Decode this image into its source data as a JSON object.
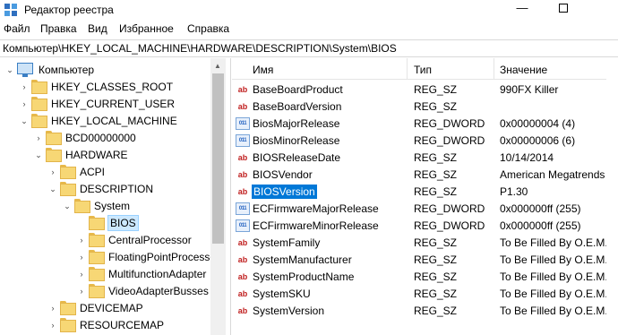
{
  "window": {
    "title": "Редактор реестра",
    "minimize": "—"
  },
  "menu": [
    "Файл",
    "Правка",
    "Вид",
    "Избранное",
    "Справка"
  ],
  "address": "Компьютер\\HKEY_LOCAL_MACHINE\\HARDWARE\\DESCRIPTION\\System\\BIOS",
  "tree": [
    {
      "label": "Компьютер",
      "toggle": "⌄",
      "icon": "computer-icon"
    },
    {
      "label": "HKEY_CLASSES_ROOT",
      "toggle": "›",
      "icon": "folder-icon"
    },
    {
      "label": "HKEY_CURRENT_USER",
      "toggle": "›",
      "icon": "folder-icon"
    },
    {
      "label": "HKEY_LOCAL_MACHINE",
      "toggle": "⌄",
      "icon": "folder-icon"
    },
    {
      "label": "BCD00000000",
      "toggle": "›",
      "icon": "folder-icon"
    },
    {
      "label": "HARDWARE",
      "toggle": "⌄",
      "icon": "folder-icon"
    },
    {
      "label": "ACPI",
      "toggle": "›",
      "icon": "folder-icon"
    },
    {
      "label": "DESCRIPTION",
      "toggle": "⌄",
      "icon": "folder-icon"
    },
    {
      "label": "System",
      "toggle": "⌄",
      "icon": "folder-icon"
    },
    {
      "label": "BIOS",
      "toggle": "",
      "icon": "folder-icon",
      "selected": true
    },
    {
      "label": "CentralProcessor",
      "toggle": "›",
      "icon": "folder-icon"
    },
    {
      "label": "FloatingPointProcesso",
      "toggle": "›",
      "icon": "folder-icon"
    },
    {
      "label": "MultifunctionAdapter",
      "toggle": "›",
      "icon": "folder-icon"
    },
    {
      "label": "VideoAdapterBusses",
      "toggle": "›",
      "icon": "folder-icon"
    },
    {
      "label": "DEVICEMAP",
      "toggle": "›",
      "icon": "folder-icon"
    },
    {
      "label": "RESOURCEMAP",
      "toggle": "›",
      "icon": "folder-icon"
    }
  ],
  "columns": {
    "name": "Имя",
    "type": "Тип",
    "data": "Значение"
  },
  "values": [
    {
      "name": "BaseBoardProduct",
      "type": "REG_SZ",
      "data": "990FX Killer",
      "icon": "ab"
    },
    {
      "name": "BaseBoardVersion",
      "type": "REG_SZ",
      "data": "",
      "icon": "ab"
    },
    {
      "name": "BiosMajorRelease",
      "type": "REG_DWORD",
      "data": "0x00000004 (4)",
      "icon": "011"
    },
    {
      "name": "BiosMinorRelease",
      "type": "REG_DWORD",
      "data": "0x00000006 (6)",
      "icon": "011"
    },
    {
      "name": "BIOSReleaseDate",
      "type": "REG_SZ",
      "data": "10/14/2014",
      "icon": "ab"
    },
    {
      "name": "BIOSVendor",
      "type": "REG_SZ",
      "data": "American Megatrends",
      "icon": "ab"
    },
    {
      "name": "BIOSVersion",
      "type": "REG_SZ",
      "data": "P1.30",
      "icon": "ab",
      "selected": true
    },
    {
      "name": "ECFirmwareMajorRelease",
      "type": "REG_DWORD",
      "data": "0x000000ff (255)",
      "icon": "011"
    },
    {
      "name": "ECFirmwareMinorRelease",
      "type": "REG_DWORD",
      "data": "0x000000ff (255)",
      "icon": "011"
    },
    {
      "name": "SystemFamily",
      "type": "REG_SZ",
      "data": "To Be Filled By O.E.M.",
      "icon": "ab"
    },
    {
      "name": "SystemManufacturer",
      "type": "REG_SZ",
      "data": "To Be Filled By O.E.M.",
      "icon": "ab"
    },
    {
      "name": "SystemProductName",
      "type": "REG_SZ",
      "data": "To Be Filled By O.E.M.",
      "icon": "ab"
    },
    {
      "name": "SystemSKU",
      "type": "REG_SZ",
      "data": "To Be Filled By O.E.M.",
      "icon": "ab"
    },
    {
      "name": "SystemVersion",
      "type": "REG_SZ",
      "data": "To Be Filled By O.E.M.",
      "icon": "ab"
    }
  ],
  "colors": {
    "selection": "#0078d7",
    "tree_selection": "#cce8ff",
    "folder": "#f7d775"
  }
}
